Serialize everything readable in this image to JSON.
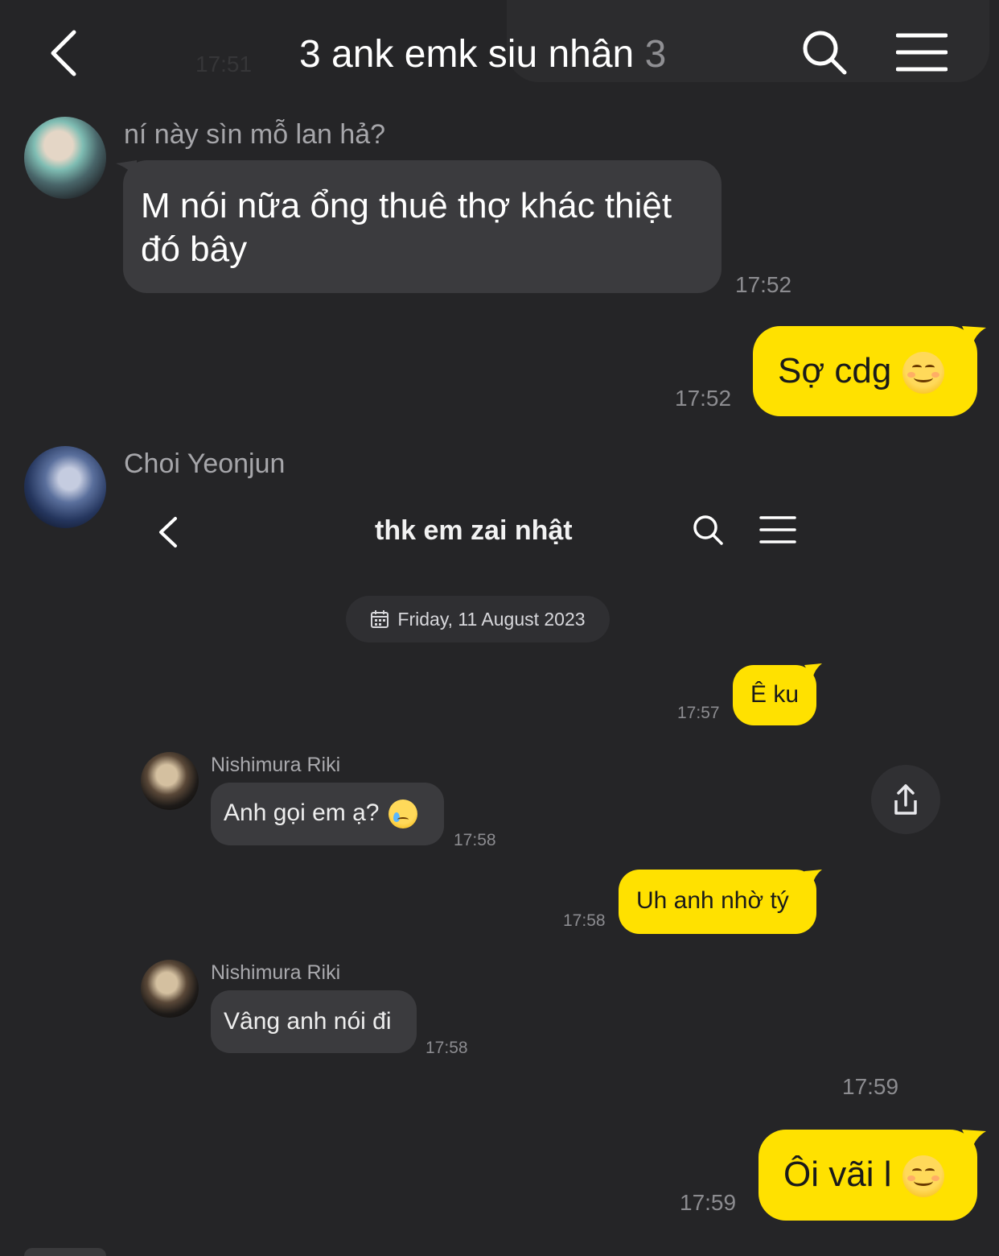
{
  "header": {
    "title": "3 ank emk siu nhân",
    "member_count": "3",
    "ghost_time": "17:51",
    "icons": [
      "back-chevron-icon",
      "search-icon",
      "menu-icon"
    ]
  },
  "messages": {
    "m1": {
      "sender": "ní này sìn mỗ lan hả?",
      "text_line1": "M nói nữa ổng thuê thợ khác thiệt",
      "text_line2": "đó bây",
      "time": "17:52"
    },
    "m2": {
      "text": "Sợ cdg",
      "time": "17:52",
      "emoji": "smiling-face"
    },
    "m3": {
      "sender": "Choi Yeonjun"
    },
    "m4": {
      "time": "17:59"
    },
    "m5": {
      "text": "Ôi vãi l",
      "time": "17:59",
      "emoji": "smiling-face"
    }
  },
  "inner_screenshot": {
    "title": "thk em zai nhật",
    "date": "Friday, 11 August 2023",
    "messages": [
      {
        "side": "out",
        "text": "Ê ku",
        "time": "17:57"
      },
      {
        "side": "in",
        "sender": "Nishimura Riki",
        "text": "Anh gọi em ạ?",
        "time": "17:58",
        "emoji": "crying-face"
      },
      {
        "side": "out",
        "text": "Uh anh nhờ tý",
        "time": "17:58"
      },
      {
        "side": "in",
        "sender": "Nishimura Riki",
        "text": "Vâng anh nói đi",
        "time": "17:58"
      }
    ]
  },
  "colors": {
    "background": "#252527",
    "incoming_bubble": "#3b3b3e",
    "outgoing_bubble": "#ffe100",
    "timestamp": "#8c8c90"
  }
}
